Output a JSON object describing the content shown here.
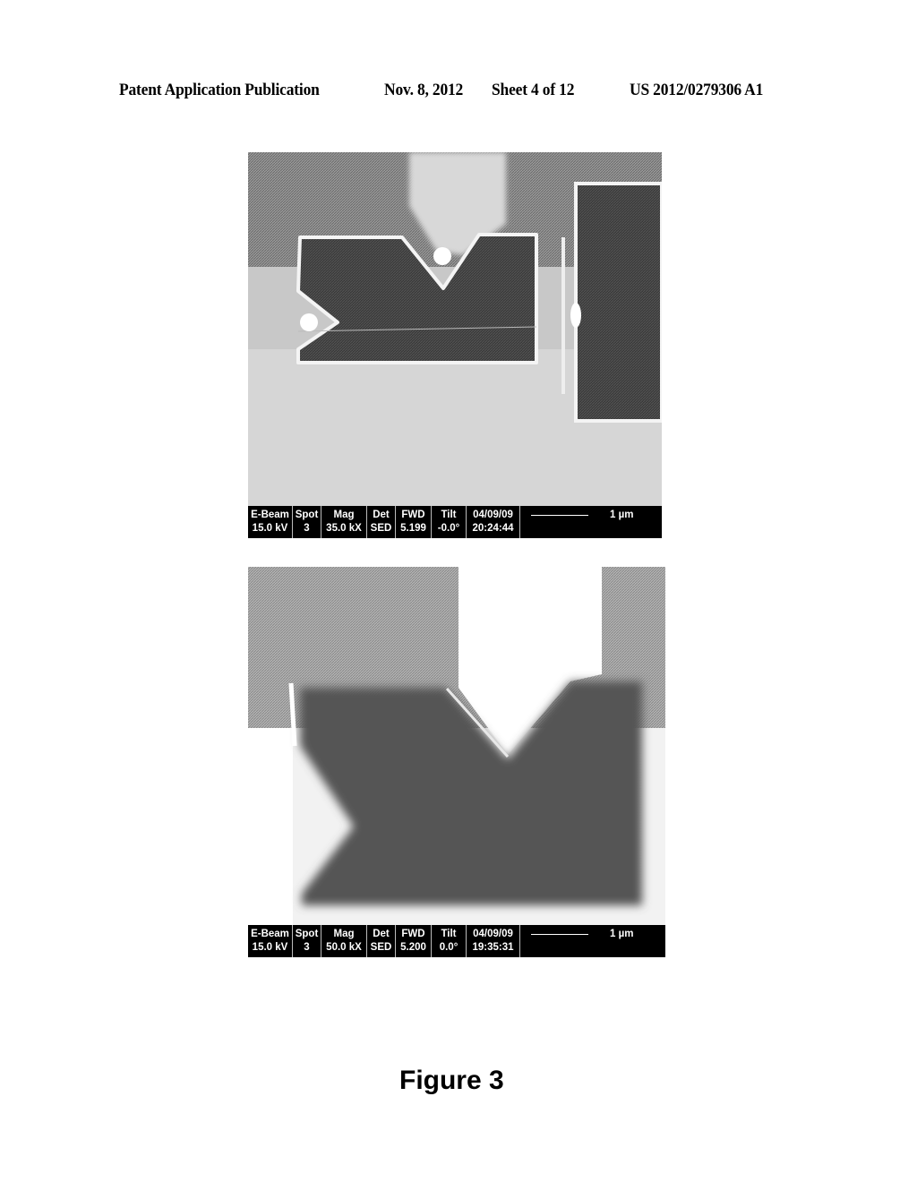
{
  "header": {
    "publication_type": "Patent Application Publication",
    "date": "Nov. 8, 2012",
    "sheet": "Sheet 4 of 12",
    "patent_number": "US 2012/0279306 A1"
  },
  "images": [
    {
      "description": "SEM micrograph: notched rectangular trench with V-notch at top and side, adjacent rectangular trench at right",
      "info_bar": {
        "headers": [
          "E-Beam",
          "Spot",
          "Mag",
          "Det",
          "FWD",
          "Tilt",
          "04/09/09"
        ],
        "values": [
          "15.0 kV",
          "3",
          "35.0 kX",
          "SED",
          "5.199",
          "-0.0°",
          "20:24:44"
        ],
        "scale_bar_label": "1 µm"
      }
    },
    {
      "description": "SEM micrograph: higher-magnification view of notched trench with V-notch",
      "info_bar": {
        "headers": [
          "E-Beam",
          "Spot",
          "Mag",
          "Det",
          "FWD",
          "Tilt",
          "04/09/09"
        ],
        "values": [
          "15.0 kV",
          "3",
          "50.0 kX",
          "SED",
          "5.200",
          "0.0°",
          "19:35:31"
        ],
        "scale_bar_label": "1 µm"
      }
    }
  ],
  "caption": "Figure 3"
}
